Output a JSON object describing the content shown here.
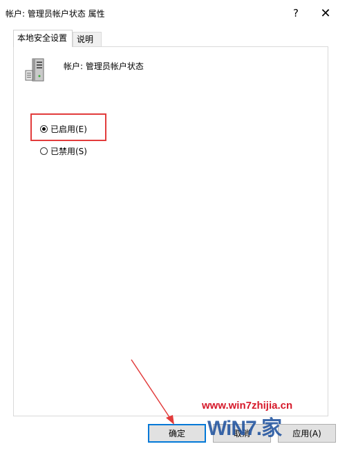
{
  "window": {
    "title": "帐户: 管理员帐户状态 属性",
    "help_glyph": "?",
    "close_glyph": "✕"
  },
  "tabs": [
    {
      "label": "本地安全设置",
      "active": true
    },
    {
      "label": "说明",
      "active": false
    }
  ],
  "panel": {
    "icon": "server-icon",
    "policy_name": "帐户: 管理员帐户状态",
    "options": [
      {
        "label": "已启用(E)",
        "checked": true
      },
      {
        "label": "已禁用(S)",
        "checked": false
      }
    ]
  },
  "buttons": {
    "ok": "确定",
    "cancel": "取消",
    "apply": "应用(A)"
  },
  "watermark": {
    "url": "www.win7zhijia.cn",
    "logo": "WiN7.家"
  },
  "colors": {
    "highlight": "#e23b3b",
    "focus": "#0078d7",
    "watermark_url": "#d6192a",
    "watermark_logo": "#1a4e9c"
  }
}
